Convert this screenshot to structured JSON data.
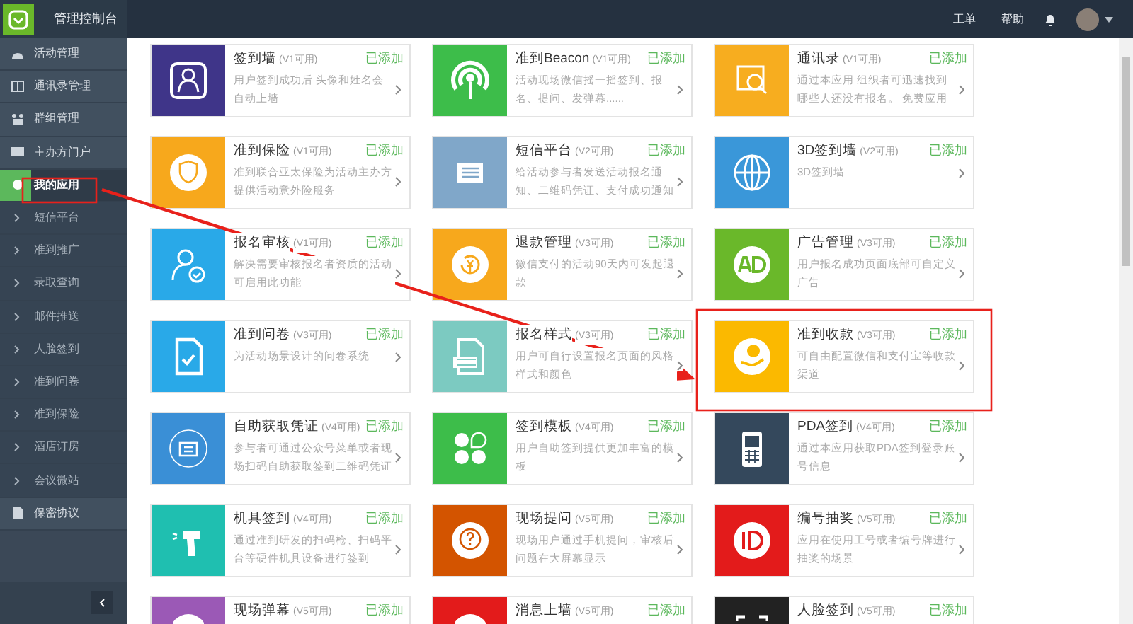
{
  "header": {
    "title": "管理控制台",
    "links": [
      "工单",
      "帮助"
    ]
  },
  "sidebar": {
    "items": [
      {
        "label": "活动管理",
        "kind": "section",
        "selected": false
      },
      {
        "label": "通讯录管理",
        "kind": "section",
        "selected": false
      },
      {
        "label": "群组管理",
        "kind": "section",
        "selected": false
      },
      {
        "label": "主办方门户",
        "kind": "section",
        "selected": false
      },
      {
        "label": "我的应用",
        "kind": "section",
        "selected": true
      },
      {
        "label": "短信平台",
        "kind": "sub",
        "selected": false
      },
      {
        "label": "准到推广",
        "kind": "sub",
        "selected": false
      },
      {
        "label": "录取查询",
        "kind": "sub",
        "selected": false
      },
      {
        "label": "邮件推送",
        "kind": "sub",
        "selected": false
      },
      {
        "label": "人脸签到",
        "kind": "sub",
        "selected": false
      },
      {
        "label": "准到问卷",
        "kind": "sub",
        "selected": false
      },
      {
        "label": "准到保险",
        "kind": "sub",
        "selected": false
      },
      {
        "label": "酒店订房",
        "kind": "sub",
        "selected": false
      },
      {
        "label": "会议微站",
        "kind": "sub",
        "selected": false
      },
      {
        "label": "保密协议",
        "kind": "section",
        "selected": false
      }
    ]
  },
  "apps": [
    {
      "title": "签到墙",
      "version": "(V1可用)",
      "status": "已添加",
      "description": "用户签到成功后 头像和姓名会自动上墙",
      "color": "#3f3589"
    },
    {
      "title": "准到Beacon",
      "version": "(V1可用)",
      "status": "已添加",
      "description": "活动现场微信摇一摇签到、报名、提问、发弹幕......",
      "color": "#3dbd4a"
    },
    {
      "title": "通讯录",
      "version": "(V1可用)",
      "status": "已添加",
      "description": "通过本应用 组织者可迅速找到哪些人还没有报名。 免费应用",
      "color": "#f7ad1f"
    },
    {
      "title": "准到保险",
      "version": "(V1可用)",
      "status": "已添加",
      "description": "准到联合亚太保险为活动主办方提供活动意外险服务",
      "color": "#f7a81c"
    },
    {
      "title": "短信平台",
      "version": "(V2可用)",
      "status": "已添加",
      "description": "给活动参与者发送活动报名通知、二维码凭证、支付成功通知",
      "color": "#80a7c9"
    },
    {
      "title": "3D签到墙",
      "version": "(V2可用)",
      "status": "已添加",
      "description": "3D签到墙",
      "color": "#3a97d9"
    },
    {
      "title": "报名审核",
      "version": "(V1可用)",
      "status": "已添加",
      "description": "解决需要审核报名者资质的活动可启用此功能",
      "color": "#29a9e8"
    },
    {
      "title": "退款管理",
      "version": "(V3可用)",
      "status": "已添加",
      "description": "微信支付的活动90天内可发起退款",
      "color": "#f7a81c"
    },
    {
      "title": "广告管理",
      "version": "(V3可用)",
      "status": "已添加",
      "description": "用户报名成功页面底部可自定义广告",
      "color": "#6ab82a"
    },
    {
      "title": "准到问卷",
      "version": "(V3可用)",
      "status": "已添加",
      "description": "为活动场景设计的问卷系统",
      "color": "#29a9e8"
    },
    {
      "title": "报名样式",
      "version": "(V3可用)",
      "status": "已添加",
      "description": "用户可自行设置报名页面的风格样式和颜色",
      "color": "#7ccac1"
    },
    {
      "title": "准到收款",
      "version": "(V3可用)",
      "status": "已添加",
      "description": "可自由配置微信和支付宝等收款渠道",
      "color": "#fbb900"
    },
    {
      "title": "自助获取凭证",
      "version": "(V4可用)",
      "status": "已添加",
      "description": "参与者可通过公众号菜单或者现场扫码自助获取签到二维码凭证",
      "color": "#3a8fd6"
    },
    {
      "title": "签到模板",
      "version": "(V4可用)",
      "status": "已添加",
      "description": "用户自助签到提供更加丰富的模板",
      "color": "#3dbd4a"
    },
    {
      "title": "PDA签到",
      "version": "(V4可用)",
      "status": "已添加",
      "description": "通过本应用获取PDA签到登录账号信息",
      "color": "#34485c"
    },
    {
      "title": "机具签到",
      "version": "(V4可用)",
      "status": "已添加",
      "description": "通过准到研发的扫码枪、扫码平台等硬件机具设备进行签到",
      "color": "#1fbfb0"
    },
    {
      "title": "现场提问",
      "version": "(V5可用)",
      "status": "已添加",
      "description": "现场用户通过手机提问，审核后问题在大屏幕显示",
      "color": "#d35400"
    },
    {
      "title": "编号抽奖",
      "version": "(V5可用)",
      "status": "已添加",
      "description": "应用在使用工号或者编号牌进行抽奖的场景",
      "color": "#e31b1b"
    },
    {
      "title": "现场弹幕",
      "version": "(V5可用)",
      "status": "已添加",
      "color": "#9b59b6"
    },
    {
      "title": "消息上墙",
      "version": "(V5可用)",
      "status": "已添加",
      "color": "#e31b1b"
    },
    {
      "title": "人脸签到",
      "version": "(V5可用)",
      "status": "已添加",
      "color": "#222222"
    }
  ]
}
